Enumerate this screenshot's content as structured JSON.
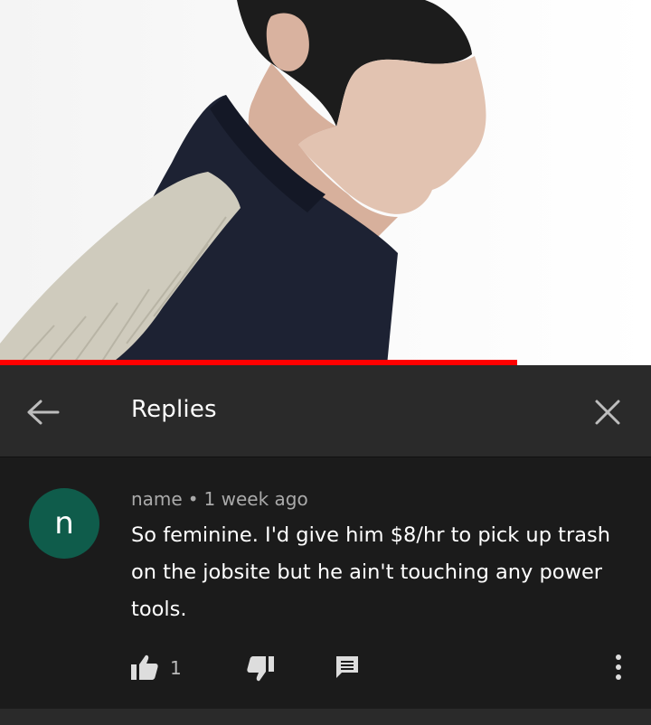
{
  "video": {
    "progress_fraction": 0.795
  },
  "header": {
    "title": "Replies",
    "back_icon": "arrow-back-icon",
    "close_icon": "close-icon"
  },
  "comment": {
    "avatar_letter": "n",
    "avatar_color": "#0f5c4b",
    "author": "name",
    "separator": "•",
    "timestamp": "1 week ago",
    "text": "So feminine.  I'd give him $8/hr to pick up trash on the jobsite but he ain't touching any power tools.",
    "like_count": "1",
    "icons": {
      "like": "thumbs-up-icon",
      "dislike": "thumbs-down-icon",
      "reply": "reply-icon",
      "more": "more-vert-icon"
    }
  },
  "colors": {
    "progress": "#ff0000",
    "header_bg": "#2a2a2a",
    "comment_bg": "#1b1b1b"
  }
}
